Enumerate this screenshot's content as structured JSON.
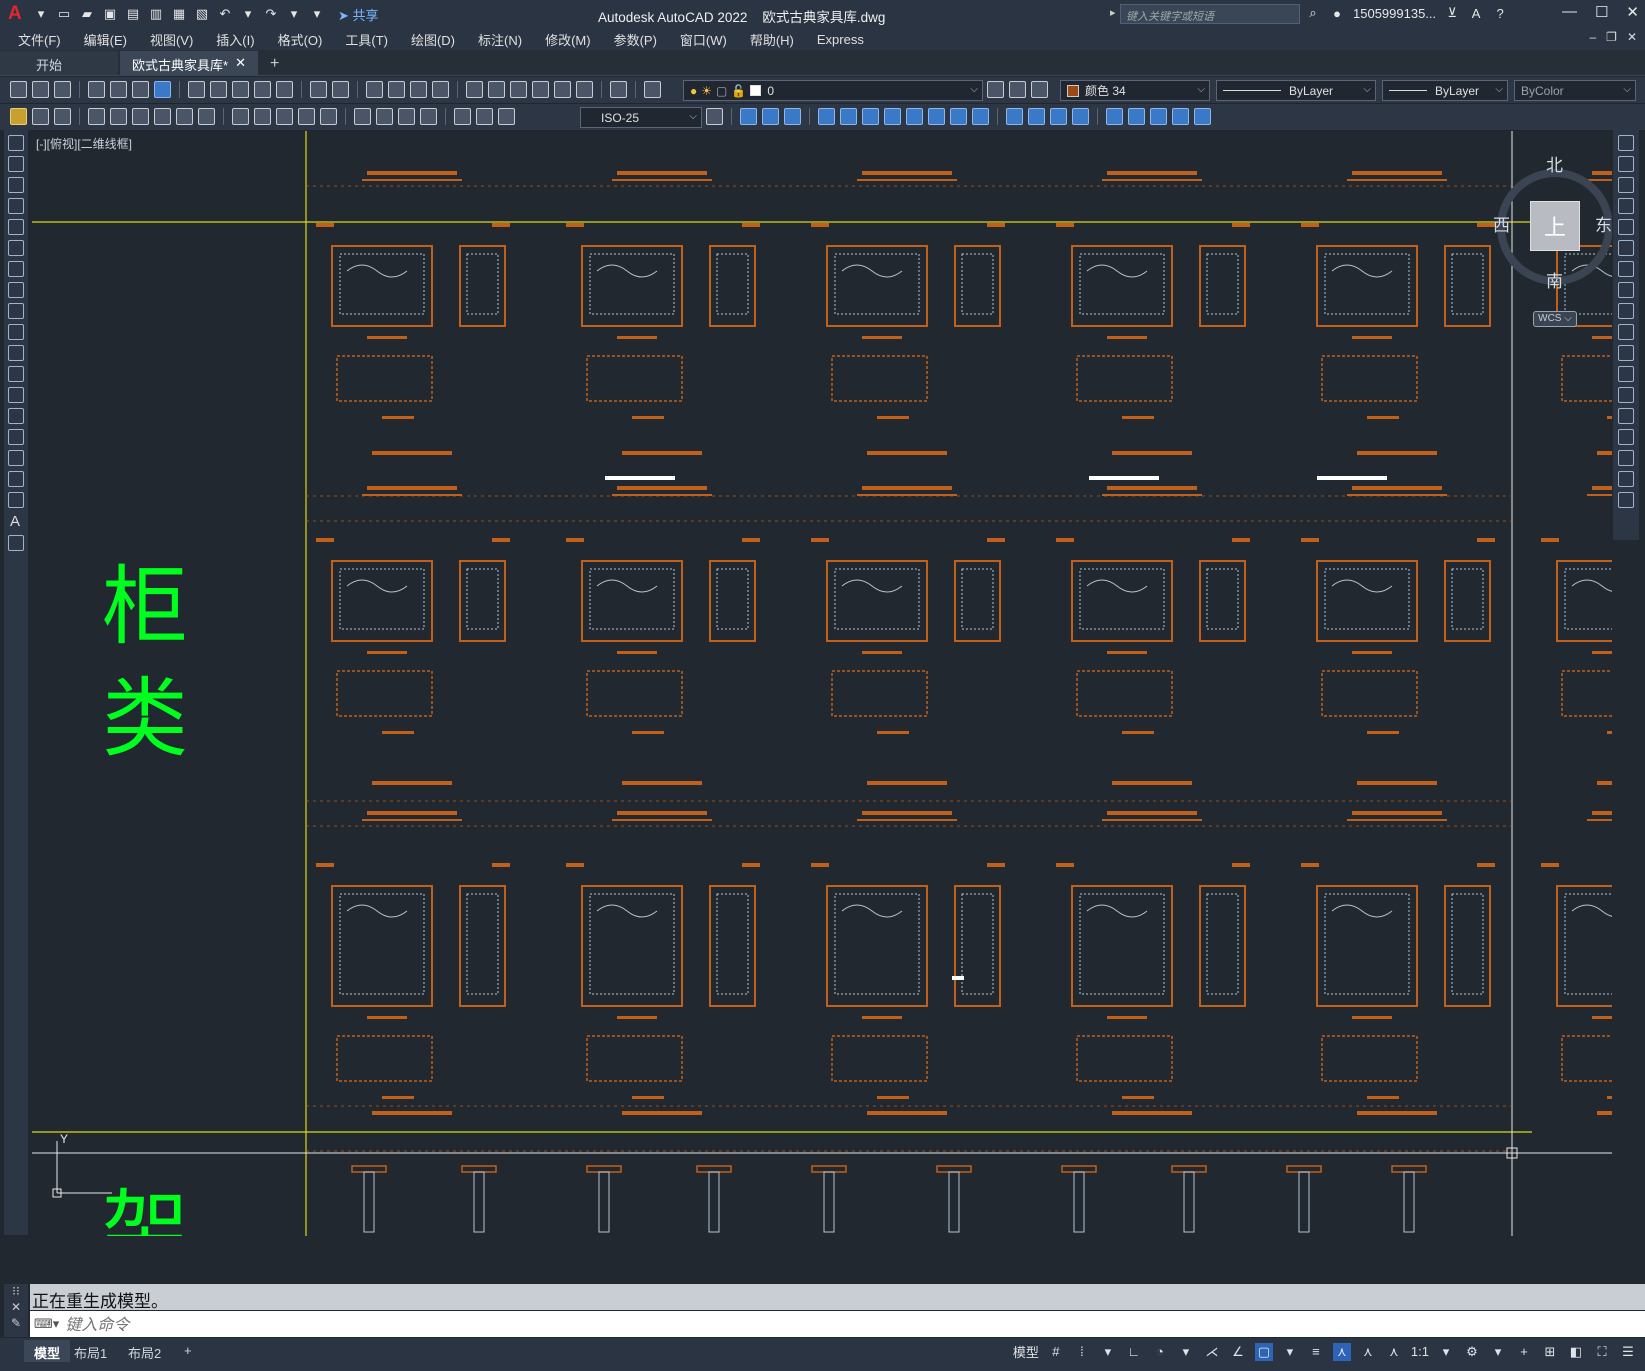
{
  "titlebar": {
    "app_title": "Autodesk AutoCAD 2022",
    "file_title": "欧式古典家具库.dwg",
    "share_label": "共享",
    "search_placeholder": "键入关键字或短语",
    "user_name": "1505999135...",
    "logo": "A"
  },
  "menu": {
    "items": [
      {
        "label": "文件(F)"
      },
      {
        "label": "编辑(E)"
      },
      {
        "label": "视图(V)"
      },
      {
        "label": "插入(I)"
      },
      {
        "label": "格式(O)"
      },
      {
        "label": "工具(T)"
      },
      {
        "label": "绘图(D)"
      },
      {
        "label": "标注(N)"
      },
      {
        "label": "修改(M)"
      },
      {
        "label": "参数(P)"
      },
      {
        "label": "窗口(W)"
      },
      {
        "label": "帮助(H)"
      },
      {
        "label": "Express"
      }
    ]
  },
  "tabs": {
    "start": "开始",
    "active": "欧式古典家具库*",
    "close": "✕",
    "add": "+"
  },
  "toolbar": {
    "layer_name": "0",
    "color_label": "颜色 34",
    "linetype": "ByLayer",
    "lineweight": "ByLayer",
    "plotstyle": "ByColor",
    "dimstyle": "ISO-25"
  },
  "canvas": {
    "viewport_label": "[-][俯视][二维线框]",
    "category_1": "柜类",
    "category_2": "架",
    "ucs_y": "Y",
    "colors": {
      "furniture": "#c0601a",
      "linework": "#b8c4d2",
      "text_green": "#00ff1e",
      "guide_yellow": "#d8d818"
    }
  },
  "viewcube": {
    "north": "北",
    "south": "南",
    "east": "东",
    "west": "西",
    "top": "上",
    "wcs": "WCS"
  },
  "command": {
    "history": "正在重生成模型。",
    "placeholder": "键入命令"
  },
  "status": {
    "layout_tabs": [
      "模型",
      "布局1",
      "布局2"
    ],
    "add_tab": "+",
    "model_label": "模型",
    "scale": "1:1"
  }
}
